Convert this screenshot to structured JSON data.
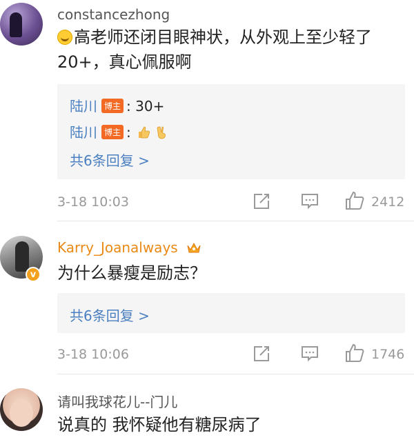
{
  "comments": [
    {
      "username": "constancezhong",
      "text": "高老师还闭目眼神状，从外观上至少轻了20+，真心佩服啊",
      "replies": [
        {
          "user": "陆川",
          "badge": "博主",
          "text": "30+"
        },
        {
          "user": "陆川",
          "badge": "博主",
          "text": ""
        }
      ],
      "more_replies": "共6条回复 >",
      "time": "3-18 10:03",
      "likes": "2412"
    },
    {
      "username": "Karry_Joanalways",
      "text": "为什么暴瘦是励志？",
      "more_replies": "共6条回复 >",
      "time": "3-18 10:06",
      "likes": "1746"
    },
    {
      "username": "请叫我球花儿--门儿",
      "text": "说真的 我怀疑他有糖尿病了"
    }
  ],
  "colors": {
    "link": "#4a7fc1",
    "vip": "#e98a16",
    "badge": "#f36a24",
    "meta": "#999999"
  },
  "icons": [
    "share-icon",
    "comment-icon",
    "like-icon",
    "crown-icon",
    "verified-icon",
    "laugh-emoji-icon",
    "thumbs-up-icon",
    "victory-hand-icon"
  ]
}
